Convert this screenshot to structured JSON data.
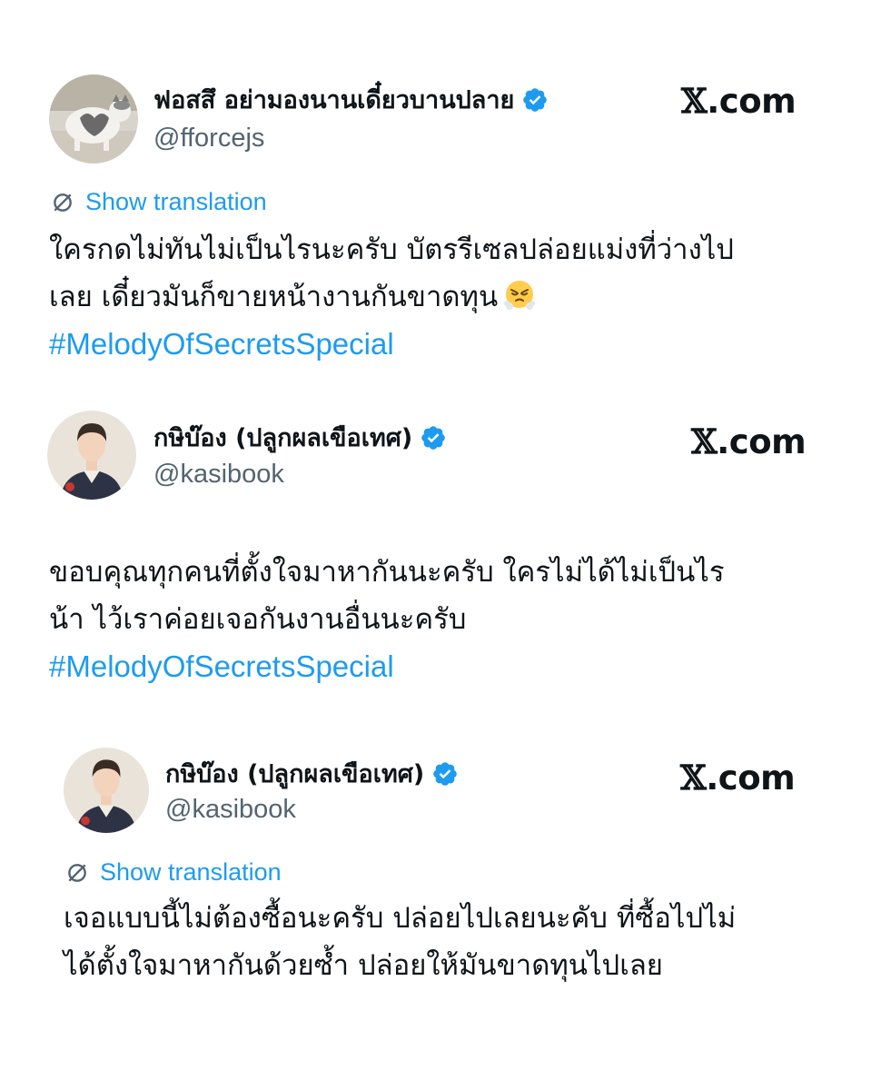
{
  "tweets": [
    {
      "display_name": "ฟอสสึ อย่ามองนานเดี๋ยวบานปลาย",
      "handle": "@fforcejs",
      "site": "X.com",
      "avatar_icon": "cat-avatar",
      "show_translation": "Show translation",
      "lines": [
        "ใครกดไม่ทันไม่เป็นไรนะครับ บัตรรีเซลปล่อยแม่งที่ว่างไป",
        "เลย เดี๋ยวมันก็ขายหน้างานกันขาดทุน"
      ],
      "emoji": "face-with-steam-from-nose",
      "hashtag": "#MelodyOfSecretsSpecial"
    },
    {
      "display_name": "กษิบ๊อง (ปลูกผลเขือเทศ)",
      "handle": "@kasibook",
      "site": "X.com",
      "avatar_icon": "person-avatar",
      "lines": [
        "ขอบคุณทุกคนที่ตั้งใจมาหากันนะครับ ใครไม่ได้ไม่เป็นไร",
        "น้า ไว้เราค่อยเจอกันงานอื่นนะครับ"
      ],
      "hashtag": "#MelodyOfSecretsSpecial"
    },
    {
      "display_name": "กษิบ๊อง (ปลูกผลเขือเทศ)",
      "handle": "@kasibook",
      "site": "X.com",
      "avatar_icon": "person-avatar",
      "show_translation": "Show translation",
      "lines": [
        "เจอแบบนี้ไม่ต้องซื้อนะครับ ปล่อยไปเลยนะคับ ที่ซื้อไปไม่",
        "ได้ตั้งใจมาหากันด้วยซ้ำ ปล่อยให้มันขาดทุนไปเลย"
      ]
    }
  ],
  "colors": {
    "text": "#0f1419",
    "handle": "#536471",
    "link": "#1d9bf0",
    "verified": "#1d9bf0"
  }
}
